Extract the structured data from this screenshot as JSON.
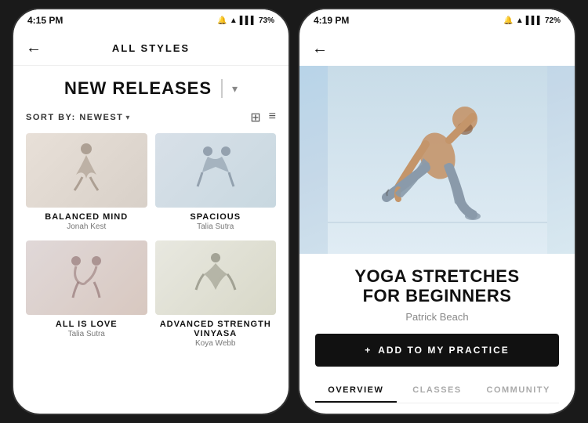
{
  "left_phone": {
    "status_bar": {
      "time": "4:15 PM",
      "battery": "73%",
      "signal": "4:15 PM"
    },
    "nav": {
      "title": "ALL STYLES",
      "back_label": "←"
    },
    "section": {
      "title": "NEW RELEASES",
      "dropdown_icon": "▾"
    },
    "sort": {
      "label": "SORT BY:",
      "value": "NEWEST",
      "chevron": "▾"
    },
    "cards": [
      {
        "id": 1,
        "title": "BALANCED MIND",
        "instructor": "Jonah Kest",
        "bg": "card-bg-1"
      },
      {
        "id": 2,
        "title": "SPACIOUS",
        "instructor": "Talia Sutra",
        "bg": "card-bg-2"
      },
      {
        "id": 3,
        "title": "ALL IS LOVE",
        "instructor": "Talia Sutra",
        "bg": "card-bg-3"
      },
      {
        "id": 4,
        "title": "ADVANCED STRENGTH VINYASA",
        "instructor": "Koya Webb",
        "bg": "card-bg-4"
      },
      {
        "id": 5,
        "title": "",
        "instructor": "",
        "bg": "card-bg-5"
      },
      {
        "id": 6,
        "title": "",
        "instructor": "",
        "bg": "card-bg-6"
      }
    ]
  },
  "right_phone": {
    "status_bar": {
      "time": "4:19 PM",
      "battery": "72%"
    },
    "nav": {
      "back_label": "←"
    },
    "hero_alt": "Yoga practitioner in stretch pose",
    "class_title_line1": "YOGA STRETCHES",
    "class_title_line2": "FOR BEGINNERS",
    "instructor": "Patrick Beach",
    "add_button": {
      "icon": "+",
      "label": "ADD TO MY PRACTICE"
    },
    "tabs": [
      {
        "label": "OVERVIEW",
        "active": true
      },
      {
        "label": "CLASSES",
        "active": false
      },
      {
        "label": "COMMUNITY",
        "active": false
      }
    ]
  }
}
